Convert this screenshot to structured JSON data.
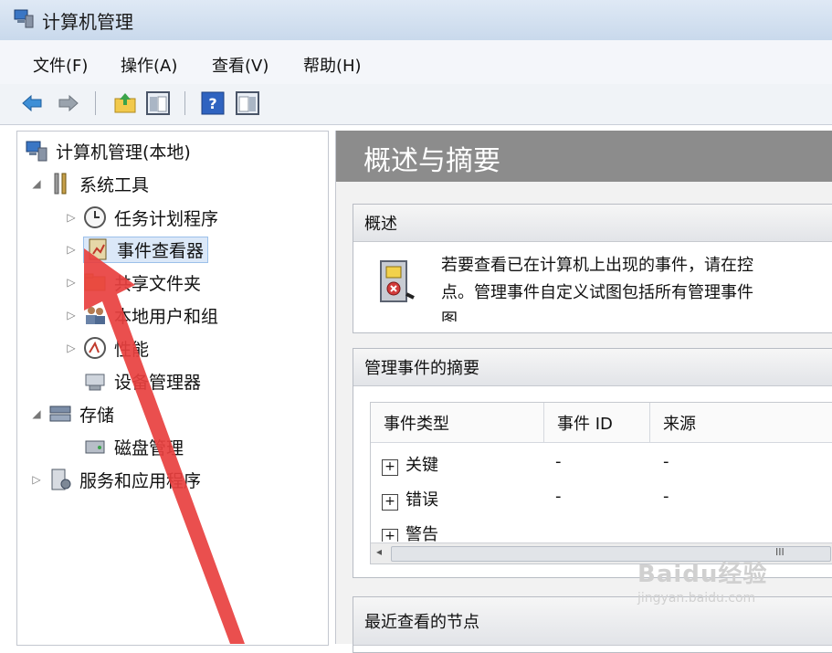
{
  "window": {
    "title": "计算机管理"
  },
  "menu": {
    "items": [
      "文件(F)",
      "操作(A)",
      "查看(V)",
      "帮助(H)"
    ]
  },
  "toolbar": {
    "buttons": [
      "back-icon",
      "forward-icon",
      "up-folder-icon",
      "console-tree-icon",
      "help-icon",
      "action-pane-icon"
    ]
  },
  "tree": {
    "root": "计算机管理(本地)",
    "system_tools": "系统工具",
    "task_scheduler": "任务计划程序",
    "event_viewer": "事件查看器",
    "shared_folders": "共享文件夹",
    "local_users": "本地用户和组",
    "performance": "性能",
    "device_manager": "设备管理器",
    "storage": "存储",
    "disk_management": "磁盘管理",
    "services_apps": "服务和应用程序"
  },
  "main": {
    "header": "概述与摘要",
    "overview": {
      "title": "概述",
      "text_line1": "若要查看已在计算机上出现的事件，请在控",
      "text_line2": "点。管理事件自定义试图包括所有管理事件",
      "text_line3": "图"
    },
    "summary": {
      "title": "管理事件的摘要",
      "columns": [
        "事件类型",
        "事件 ID",
        "来源"
      ],
      "rows": [
        {
          "type": "关键",
          "id": "-",
          "source": "-"
        },
        {
          "type": "错误",
          "id": "-",
          "source": "-"
        },
        {
          "type": "警告",
          "id": "",
          "source": ""
        }
      ],
      "scroll_grip": "III"
    },
    "recent": {
      "title": "最近查看的节点"
    }
  },
  "watermark": {
    "brand": "Baidu经验",
    "url": "jingyan.baidu.com"
  }
}
